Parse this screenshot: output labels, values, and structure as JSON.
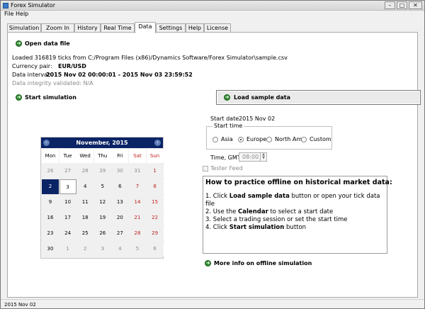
{
  "window": {
    "title": "Forex Simulator",
    "minimize": "–",
    "maximize": "□",
    "close": "✕"
  },
  "menu": {
    "file": "File",
    "help": "Help"
  },
  "tabs": [
    "Simulation",
    "Zoom In",
    "History",
    "Real Time",
    "Data",
    "Settings",
    "Help",
    "License"
  ],
  "active_tab": "Data",
  "data_panel": {
    "open_label": "Open data file",
    "loaded_text": "Loaded 316819 ticks from C:/Program Files (x86)/Dynamics Software/Forex Simulator\\sample.csv",
    "pair_label": "Currency pair:",
    "pair_value": "EUR/USD",
    "interval_label": "Data interval:",
    "interval_value": "2015 Nov 02 00:00:01 - 2015 Nov 03 23:59:52",
    "integrity_text": "Data integrity validated: N/A",
    "start_sim_label": "Start simulation",
    "load_sample_label": "Load sample data"
  },
  "calendar": {
    "month_title": "November,  2015",
    "prev": "‹",
    "next": "›",
    "weekdays": [
      "Mon",
      "Tue",
      "Wed",
      "Thu",
      "Fri",
      "Sat",
      "Sun"
    ],
    "weeks": [
      [
        "26",
        "27",
        "28",
        "29",
        "30",
        "31",
        "1"
      ],
      [
        "2",
        "3",
        "4",
        "5",
        "6",
        "7",
        "8"
      ],
      [
        "9",
        "10",
        "11",
        "12",
        "13",
        "14",
        "15"
      ],
      [
        "16",
        "17",
        "18",
        "19",
        "20",
        "21",
        "22"
      ],
      [
        "23",
        "24",
        "25",
        "26",
        "27",
        "28",
        "29"
      ],
      [
        "30",
        "1",
        "2",
        "3",
        "4",
        "5",
        "6"
      ]
    ],
    "selected_day": "2",
    "today_day": "3"
  },
  "session": {
    "start_date_label": "Start date",
    "start_date_value": "2015 Nov 02",
    "start_time_legend": "Start time",
    "options": [
      "Asia",
      "Europe",
      "North Am.",
      "Custom"
    ],
    "selected": "Europe",
    "time_gmt_label": "Time, GMT",
    "time_value": "08:00",
    "tester_feed_label": "Tester Feed"
  },
  "howto": {
    "heading": "How to practice offline on historical market data:",
    "step1_pre": "1. Click ",
    "step1_bold": "Load sample data",
    "step1_post": " button or open your tick data",
    "step1_line2": "file",
    "step2_pre": "2. Use the ",
    "step2_bold": "Calendar",
    "step2_post": " to select a start date",
    "step3": "3. Select a trading session or set the start time",
    "step4_pre": "4. Click ",
    "step4_bold": "Start simulation",
    "step4_post": " button"
  },
  "more_info_label": "More info on offline simulation",
  "status": {
    "text": "2015 Nov 02"
  },
  "colors": {
    "accent": "#0a2466",
    "weekend": "#c02020",
    "icon_green": "#2e8b2e"
  }
}
